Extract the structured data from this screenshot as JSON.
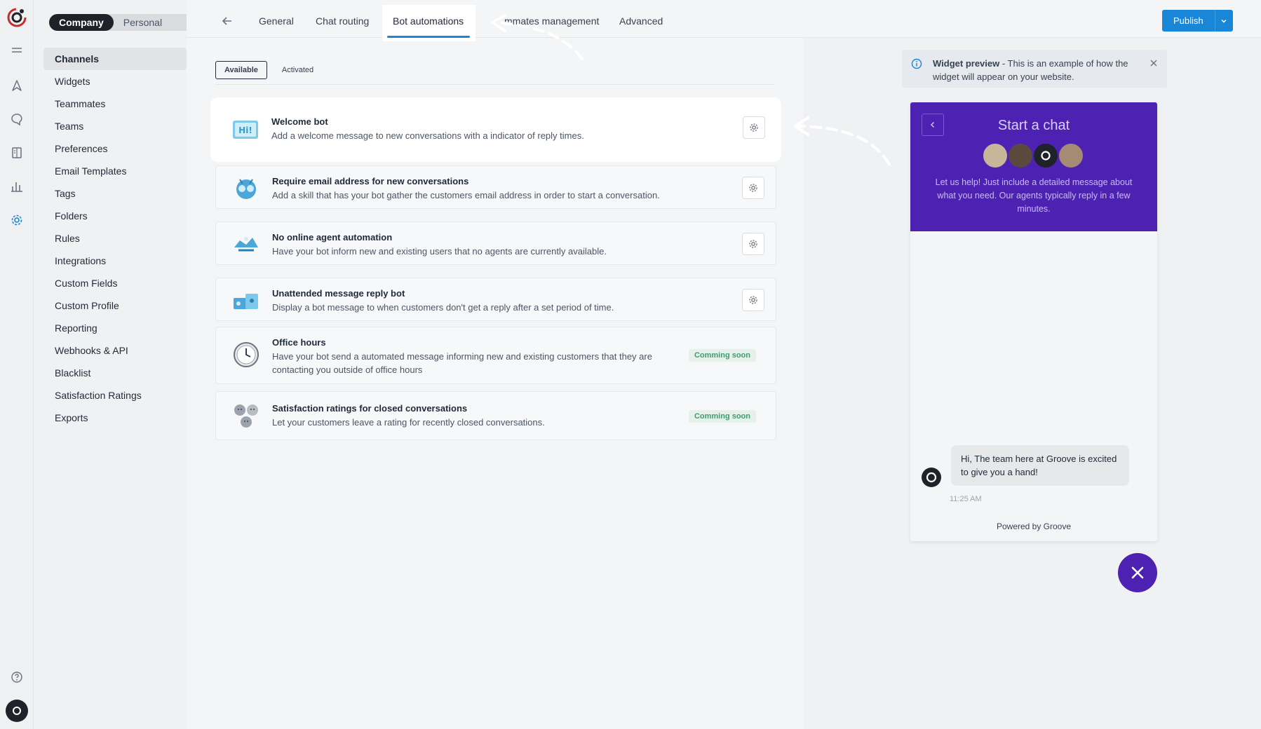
{
  "segment": {
    "company": "Company",
    "personal": "Personal"
  },
  "nav": [
    "Channels",
    "Widgets",
    "Teammates",
    "Teams",
    "Preferences",
    "Email Templates",
    "Tags",
    "Folders",
    "Rules",
    "Integrations",
    "Custom Fields",
    "Custom Profile",
    "Reporting",
    "Webhooks & API",
    "Blacklist",
    "Satisfaction Ratings",
    "Exports"
  ],
  "tabs": {
    "general": "General",
    "chat_routing": "Chat routing",
    "bot_automations": "Bot automations",
    "teammates_management": "mmates management",
    "advanced": "Advanced"
  },
  "subtabs": {
    "available": "Available",
    "activated": "Activated"
  },
  "cards": [
    {
      "title": "Welcome bot",
      "desc": "Add a welcome message to new conversations with a indicator of reply times."
    },
    {
      "title": "Require email address for new conversations",
      "desc": "Add a skill that has your bot gather the customers email address in order to start a conversation."
    },
    {
      "title": "No online agent automation",
      "desc": "Have your bot inform new and existing users that no agents are currently available."
    },
    {
      "title": "Unattended message reply bot",
      "desc": "Display a bot message to when customers don't get a reply after a set period of time."
    },
    {
      "title": "Office hours",
      "desc": "Have your bot send a automated message informing new and existing customers that they are contacting you outside of office hours",
      "badge": "Comming soon"
    },
    {
      "title": "Satisfaction ratings for closed conversations",
      "desc": "Let your customers leave a rating for recently closed conversations.",
      "badge": "Comming soon"
    }
  ],
  "publish": "Publish",
  "notice": {
    "bold": "Widget preview",
    "text": " - This is an example of how the widget will appear on your website."
  },
  "widget": {
    "title": "Start a chat",
    "subtitle": "Let us help! Just include a detailed message about what you need. Our agents typically reply in a few minutes.",
    "message": "Hi, The team here at Groove is excited to give you a hand!",
    "time": "11:25 AM",
    "powered": "Powered by Groove"
  },
  "colors": {
    "accent": "#1a86d8",
    "widget": "#4d22b3",
    "badge": "#3e9c73"
  }
}
